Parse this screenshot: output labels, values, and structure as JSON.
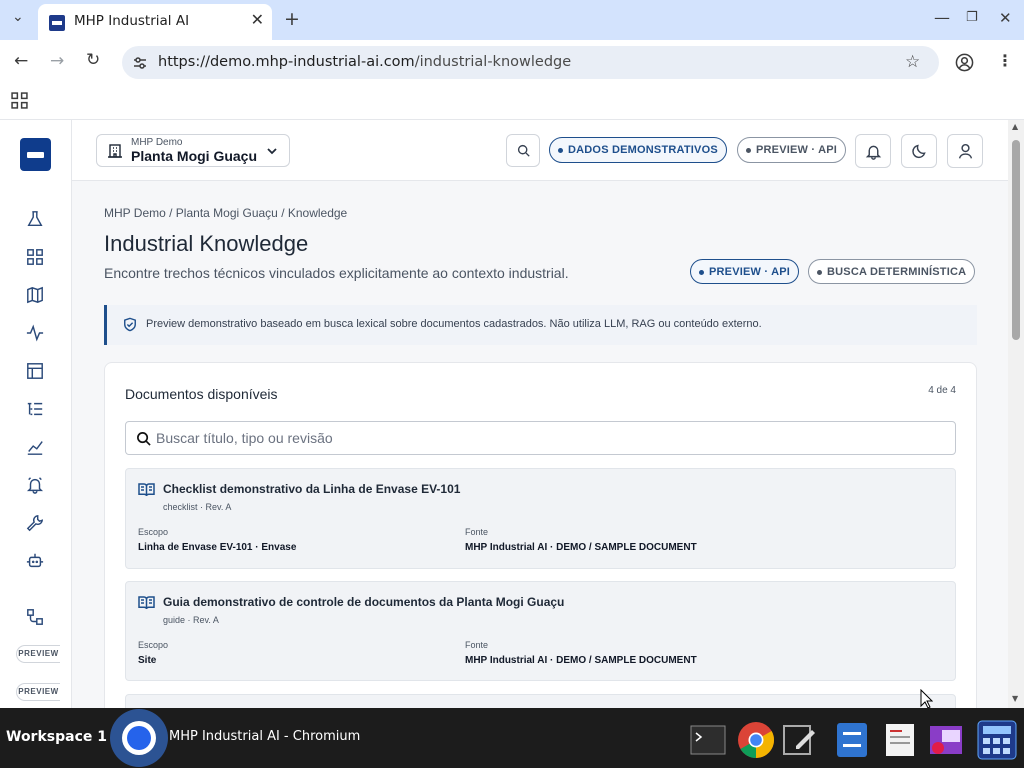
{
  "browser": {
    "tab_title": "MHP Industrial AI",
    "url_host": "https://demo.mhp-industrial-ai.com",
    "url_path": "/industrial-knowledge"
  },
  "header": {
    "org": "MHP Demo",
    "site": "Planta Mogi Guaçu",
    "badge_demo": "DADOS DEMONSTRATIVOS",
    "badge_preview": "PREVIEW · API"
  },
  "sidebar": {
    "pill_1": "PREVIEW",
    "pill_2": "PREVIEW"
  },
  "page": {
    "breadcrumb": "MHP Demo / Planta Mogi Guaçu / Knowledge",
    "title": "Industrial Knowledge",
    "subtitle": "Encontre trechos técnicos vinculados explicitamente ao contexto industrial.",
    "badge_preview": "PREVIEW · API",
    "badge_search": "BUSCA DETERMINÍSTICA",
    "notice": "Preview demonstrativo baseado em busca lexical sobre documentos cadastrados. Não utiliza LLM, RAG ou conteúdo externo."
  },
  "docs": {
    "title": "Documentos disponíveis",
    "count": "4 de 4",
    "search_placeholder": "Buscar título, tipo ou revisão",
    "scope_label": "Escopo",
    "source_label": "Fonte",
    "items": [
      {
        "title": "Checklist demonstrativo da Linha de Envase EV-101",
        "meta": "checklist · Rev. A",
        "scope": "Linha de Envase EV-101 · Envase",
        "source": "MHP Industrial AI · DEMO / SAMPLE DOCUMENT"
      },
      {
        "title": "Guia demonstrativo de controle de documentos da Planta Mogi Guaçu",
        "meta": "guide · Rev. A",
        "scope": "Site",
        "source": "MHP Industrial AI · DEMO / SAMPLE DOCUMENT"
      }
    ]
  },
  "taskbar": {
    "workspace": "Workspace 1",
    "active_app": "MHP Industrial AI - Chromium"
  },
  "colors": {
    "brand": "#0f3c8c",
    "accent": "#1e4f8c"
  }
}
